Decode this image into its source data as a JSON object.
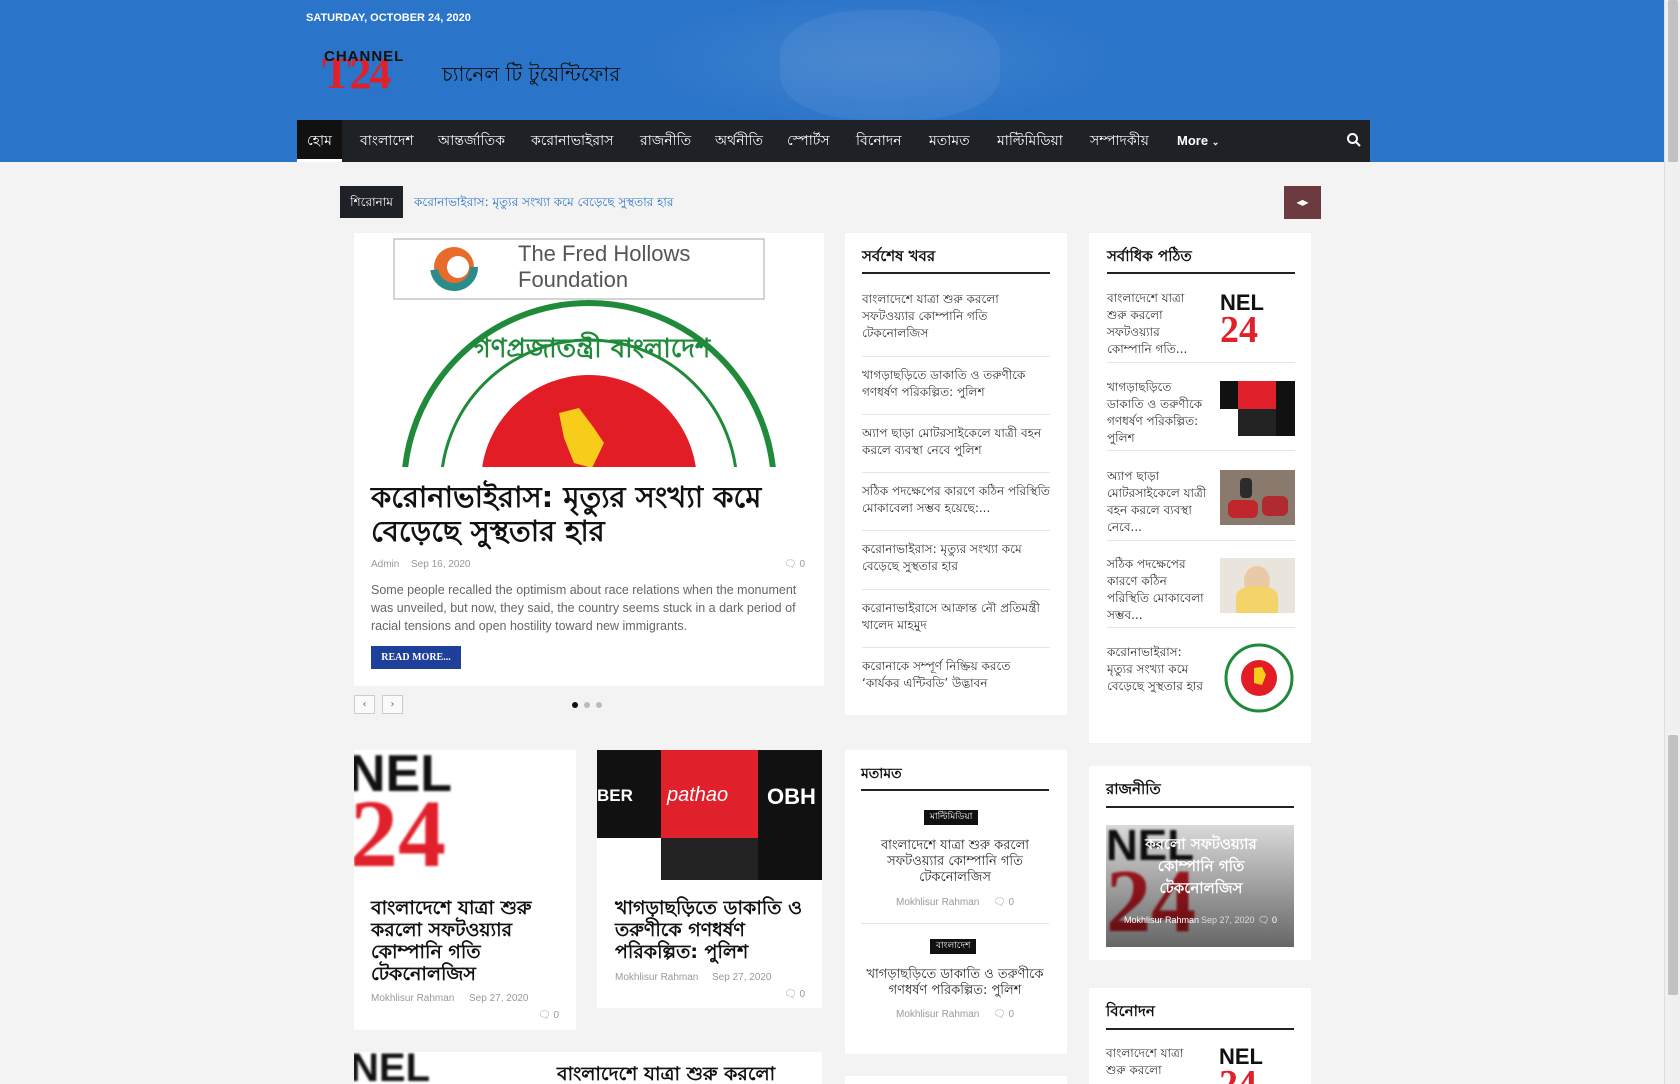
{
  "header": {
    "date": "SATURDAY, OCTOBER 24, 2020",
    "logo_channel": "CHANNEL",
    "logo_t24": "T24",
    "logo_bangla": "চ্যানেল টি টুয়েন্টিফোর"
  },
  "nav": {
    "items": [
      "হোম",
      "বাংলাদেশ",
      "আন্তর্জাতিক",
      "করোনাভাইরাস",
      "রাজনীতি",
      "অর্থনীতি",
      "স্পোর্টস",
      "বিনোদন",
      "মতামত",
      "মাল্টিমিডিয়া",
      "সম্পাদকীয়",
      "More"
    ]
  },
  "ticker": {
    "label": "শিরোনাম",
    "text": "করোনাভাইরাস: মৃত্যুর সংখ্যা কমে বেড়েছে সুস্থতার হার"
  },
  "hero": {
    "logo_text_1": "The Fred Hollows",
    "logo_text_2": "Foundation",
    "seal_text": "গণপ্রজাতন্ত্রী বাংলাদেশ",
    "title": "করোনাভাইরাস: মৃত্যুর সংখ্যা কমে বেড়েছে সুস্থতার হার",
    "author": "Admin",
    "date": "Sep 16, 2020",
    "comments": "0",
    "excerpt": "Some people recalled the optimism about race relations when the monument was unveiled, but now, they said, the country seems stuck in a dark period of racial tensions and open hostility toward new immigrants.",
    "read_more": "READ MORE..."
  },
  "latest": {
    "title": "সর্বশেষ খবর",
    "items": [
      "বাংলাদেশে যাত্রা শুরু করলো সফটওয়্যার কোম্পানি গতি টেকনোলজিস",
      "খাগড়াছড়িতে ডাকাতি ও তরুণীকে গণধর্ষণ পরিকল্পিত: পুলিশ",
      "অ্যাপ ছাড়া মোটরসাইকেলে যাত্রী বহন করলে ব্যবস্থা নেবে পুলিশ",
      "সঠিক পদক্ষেপের কারণে কঠিন পরিস্থিতি মোকাবেলা সম্ভব হয়েছে:...",
      "করোনাভাইরাস: মৃত্যুর সংখ্যা কমে বেড়েছে সুস্থতার হার",
      "করোনাভাইরাসে আক্রান্ত নৌ প্রতিমন্ত্রী খালেদ মাহমুদ",
      "করোনাকে সম্পূর্ণ নিষ্ক্রিয় করতে ‘কার্যকর এন্টিবডি’ উদ্ভাবন"
    ]
  },
  "popular": {
    "title": "সর্বাধিক পঠিত",
    "items": [
      "বাংলাদেশে যাত্রা শুরু করলো সফটওয়্যার কোম্পানি গতি...",
      "খাগড়াছড়িতে ডাকাতি ও তরুণীকে গণধর্ষণ পরিকল্পিত: পুলিশ",
      "অ্যাপ ছাড়া মোটরসাইকেলে যাত্রী বহন করলে ব্যবস্থা নেবে...",
      "সঠিক পদক্ষেপের কারণে কঠিন পরিস্থিতি মোকাবেলা সম্ভব...",
      "করোনাভাইরাস: মৃত্যুর সংখ্যা কমে বেড়েছে সুস্থতার হার"
    ]
  },
  "cards": [
    {
      "title": "বাংলাদেশে যাত্রা শুরু করলো সফটওয়্যার কোম্পানি গতি টেকনোলজিস",
      "author": "Mokhlisur Rahman",
      "date": "Sep 27, 2020",
      "comments": "0"
    },
    {
      "title": "খাগড়াছড়িতে ডাকাতি ও তরুণীকে গণধর্ষণ পরিকল্পিত: পুলিশ",
      "author": "Mokhlisur Rahman",
      "date": "Sep 27, 2020",
      "comments": "0"
    }
  ],
  "opinion": {
    "title": "মতামত",
    "items": [
      {
        "badge": "মাল্টিমিডিয়া",
        "title": "বাংলাদেশে যাত্রা শুরু করলো সফটওয়্যার কোম্পানি গতি টেকনোলজিস",
        "author": "Mokhlisur Rahman",
        "comments": "0"
      },
      {
        "badge": "বাংলাদেশ",
        "title": "খাগড়াছড়িতে ডাকাতি ও তরুণীকে গণধর্ষণ পরিকল্পিত: পুলিশ",
        "author": "Mokhlisur Rahman",
        "comments": "0"
      }
    ]
  },
  "politics": {
    "title": "রাজনীতি",
    "overlay_title": "করলো সফটওয়্যার কোম্পানি গতি টেকনোলজিস",
    "author": "Mokhlisur Rahman",
    "date": "Sep 27, 2020",
    "comments": "0"
  },
  "entertainment": {
    "title": "বিনোদন",
    "item": "বাংলাদেশে যাত্রা শুরু করলো"
  },
  "bottom": {
    "title": "বাংলাদেশে যাত্রা শুরু করলো"
  },
  "thumb_text": {
    "nel": "NEL",
    "ber": "BER",
    "pathao": "pathao",
    "obh": "OBH"
  }
}
